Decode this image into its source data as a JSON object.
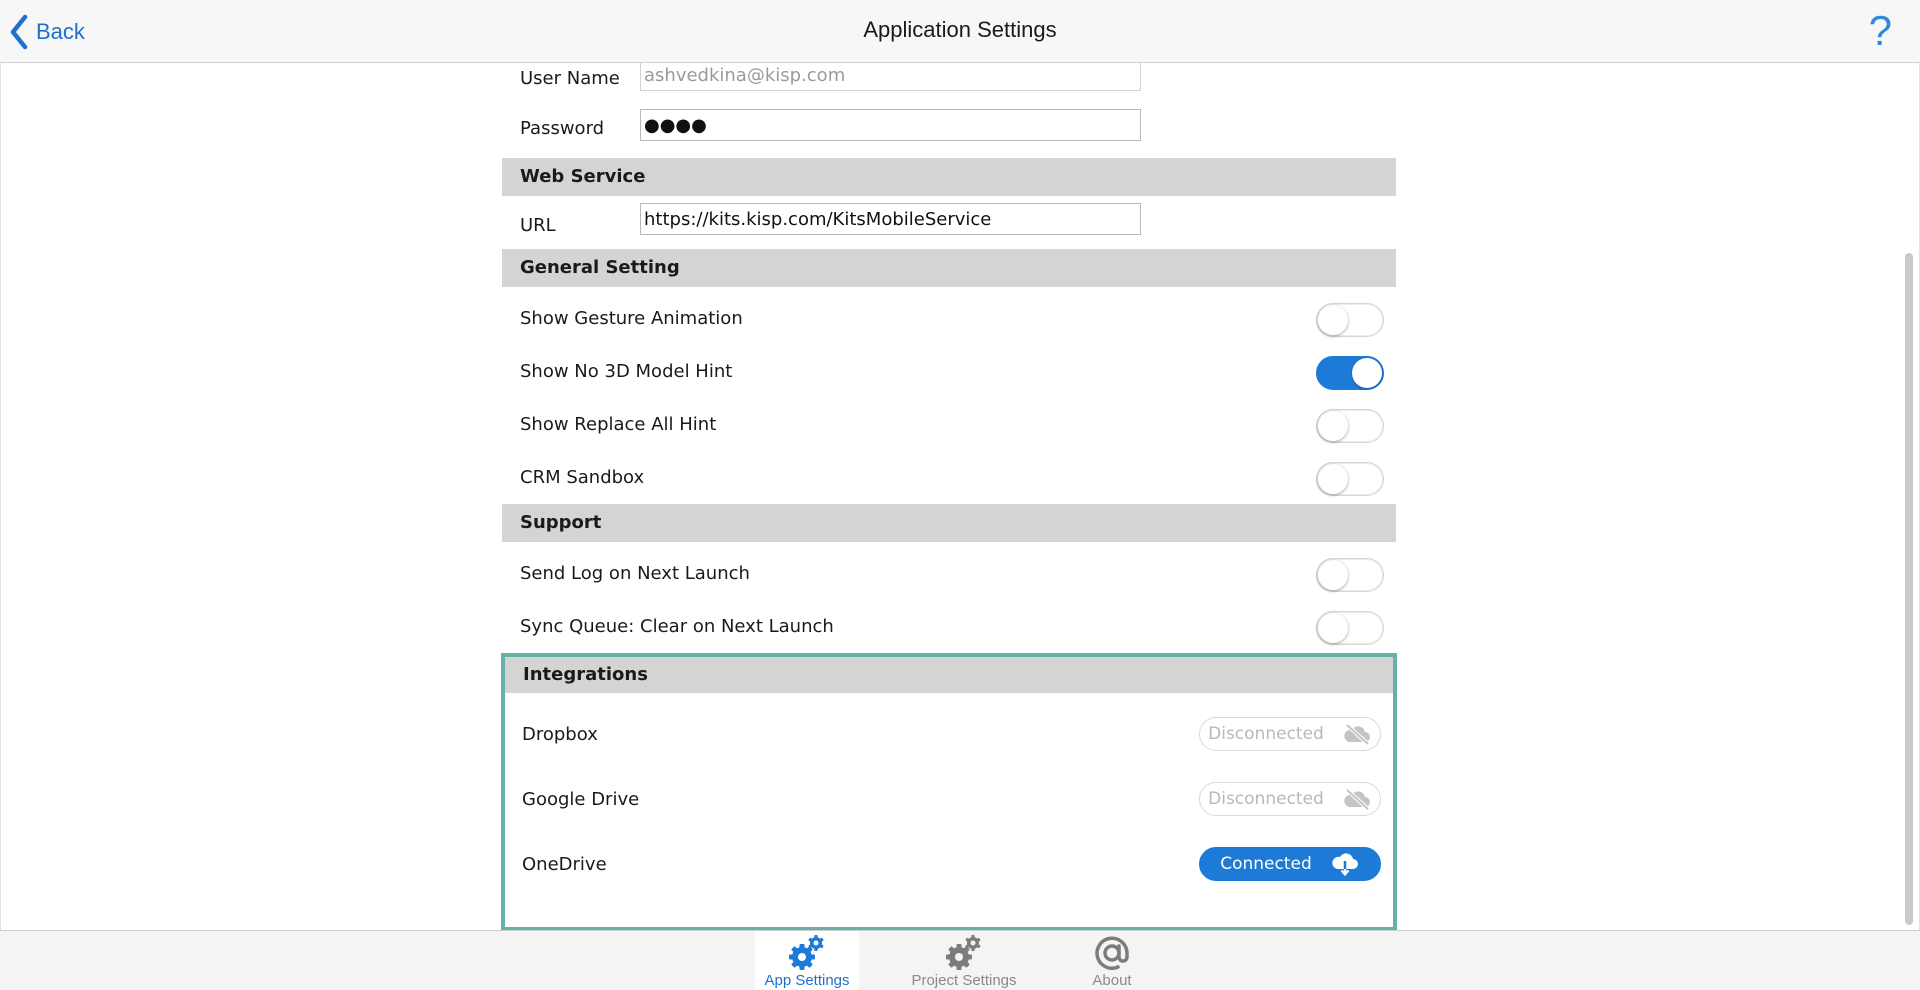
{
  "header": {
    "back_label": "Back",
    "title": "Application Settings",
    "help_label": "?"
  },
  "account": {
    "user_name_label": "User Name",
    "user_name_value": "ashvedkina@kisp.com",
    "password_label": "Password",
    "password_value": "●●●●"
  },
  "web_service": {
    "title": "Web Service",
    "url_label": "URL",
    "url_value": "https://kits.kisp.com/KitsMobileService"
  },
  "general": {
    "title": "General Setting",
    "items": [
      {
        "label": "Show Gesture Animation",
        "on": false
      },
      {
        "label": "Show No 3D Model Hint",
        "on": true
      },
      {
        "label": "Show Replace All Hint",
        "on": false
      },
      {
        "label": "CRM Sandbox",
        "on": false
      }
    ]
  },
  "support": {
    "title": "Support",
    "items": [
      {
        "label": "Send Log on Next Launch",
        "on": false
      },
      {
        "label": "Sync Queue: Clear on Next Launch",
        "on": false
      }
    ]
  },
  "integrations": {
    "title": "Integrations",
    "items": [
      {
        "label": "Dropbox",
        "status": "Disconnected",
        "icon": "cloud-off-icon"
      },
      {
        "label": "Google Drive",
        "status": "Disconnected",
        "icon": "cloud-off-icon"
      },
      {
        "label": "OneDrive",
        "status": "Connected",
        "icon": "cloud-download-icon"
      }
    ]
  },
  "tabs": [
    {
      "label": "App Settings",
      "icon": "gears-icon",
      "active": true
    },
    {
      "label": "Project Settings",
      "icon": "gears-icon",
      "active": false
    },
    {
      "label": "About",
      "icon": "at-sign-icon",
      "active": false
    }
  ],
  "colors": {
    "accent": "#1d7ad7",
    "link": "#1f6fcf",
    "section_header": "#d4d4d4",
    "highlight_border": "#69b1a8"
  }
}
